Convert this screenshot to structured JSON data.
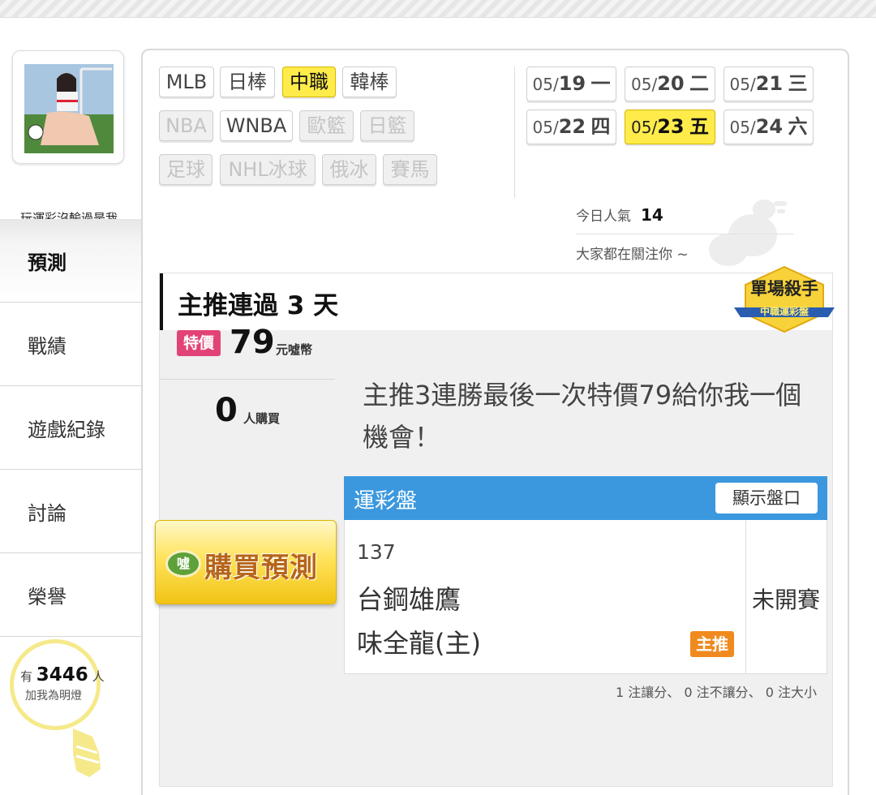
{
  "profile": {
    "nickname": "玩運彩沒輸過是我"
  },
  "nav": [
    {
      "label": "預測",
      "active": true
    },
    {
      "label": "戰績"
    },
    {
      "label": "遊戲紀錄"
    },
    {
      "label": "討論"
    },
    {
      "label": "榮譽"
    }
  ],
  "fans": {
    "prefix": "有",
    "count": "3446",
    "suffix": "人",
    "caption": "加我為明燈"
  },
  "sport_tabs": [
    {
      "label": "MLB"
    },
    {
      "label": "日棒"
    },
    {
      "label": "中職",
      "active": true
    },
    {
      "label": "韓棒"
    },
    {
      "label": "NBA",
      "disabled": true
    },
    {
      "label": "WNBA"
    },
    {
      "label": "歐籃",
      "disabled": true
    },
    {
      "label": "日籃",
      "disabled": true
    },
    {
      "label": "足球",
      "disabled": true
    },
    {
      "label": "NHL冰球",
      "disabled": true
    },
    {
      "label": "俄冰",
      "disabled": true
    },
    {
      "label": "賽馬",
      "disabled": true
    }
  ],
  "dates": [
    {
      "md": "05/",
      "day": "19",
      "wd": "一"
    },
    {
      "md": "05/",
      "day": "20",
      "wd": "二"
    },
    {
      "md": "05/",
      "day": "21",
      "wd": "三"
    },
    {
      "md": "05/",
      "day": "22",
      "wd": "四"
    },
    {
      "md": "05/",
      "day": "23",
      "wd": "五",
      "active": true
    },
    {
      "md": "05/",
      "day": "24",
      "wd": "六"
    }
  ],
  "popularity": {
    "label": "今日人氣",
    "value": "14",
    "subtitle": "大家都在關注你 ~"
  },
  "section": {
    "title": "主推連過 3 天",
    "badge_line1": "單場殺手",
    "badge_line2": "中職運彩盤"
  },
  "offer": {
    "special_label": "特價",
    "price": "79",
    "price_unit": "元噓幣",
    "buyers": "0",
    "buyers_unit": "人購買",
    "buy_label": "購買預測",
    "buy_icon_text": "噓",
    "description": "主推3連勝最後一次特價79給你我一個機會！"
  },
  "pan": {
    "title": "運彩盤",
    "show_button": "顯示盤口",
    "game_number": "137",
    "away_team": "台鋼雄鷹",
    "home_team": "味全龍(主)",
    "main_tag": "主推",
    "status": "未開賽"
  },
  "summary": "1 注讓分、 0 注不讓分、 0 注大小",
  "colors": {
    "active_yellow": "#ffec4a",
    "pan_blue": "#3b98de",
    "special_pink": "#e24377",
    "main_orange": "#f08a1e"
  }
}
